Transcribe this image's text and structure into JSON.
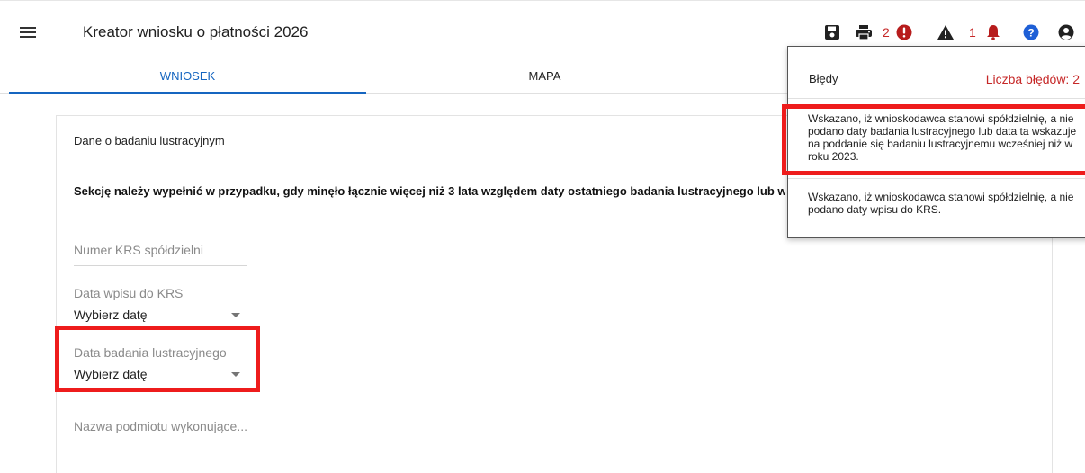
{
  "header": {
    "title": "Kreator wniosku o płatności 2026",
    "error_count": "2",
    "warning_count": "1"
  },
  "icons": {
    "menu": "menu-icon",
    "save": "save-icon",
    "print": "print-icon",
    "error": "error-icon",
    "warning": "warning-icon",
    "notification": "bell-icon",
    "help": "help-icon",
    "account": "account-icon"
  },
  "tabs": [
    {
      "label": "WNIOSEK",
      "active": true
    },
    {
      "label": "MAPA",
      "active": false
    }
  ],
  "form": {
    "section_title": "Dane o badaniu lustracyjnym",
    "section_note": "Sekcję należy wypełnić w przypadku, gdy minęło łącznie więcej niż 3 lata względem daty ostatniego badania lustracyjnego lub w",
    "fields": {
      "krs_number": {
        "placeholder": "Numer KRS spółdzielni",
        "value": ""
      },
      "krs_date": {
        "label": "Data wpisu do KRS",
        "value": "Wybierz datę"
      },
      "audit_date": {
        "label": "Data badania lustracyjnego",
        "value": "Wybierz datę"
      },
      "auditor_name": {
        "placeholder": "Nazwa podmiotu wykonujące...",
        "value": ""
      }
    }
  },
  "errors_popup": {
    "title": "Błędy",
    "count_label": "Liczba błędów: 2",
    "items": [
      "Wskazano, iż wnioskodawca stanowi spółdzielnię, a nie podano daty badania lustracyjnego lub data ta wskazuje na poddanie się badaniu lustracyjnemu wcześniej niż w roku 2023.",
      "Wskazano, iż wnioskodawca stanowi spółdzielnię, a nie podano daty wpisu do KRS."
    ]
  },
  "colors": {
    "accent": "#1565c0",
    "error_red": "#c62828",
    "highlight": "#ee1c1c",
    "toolbar_icon": "#212121"
  }
}
